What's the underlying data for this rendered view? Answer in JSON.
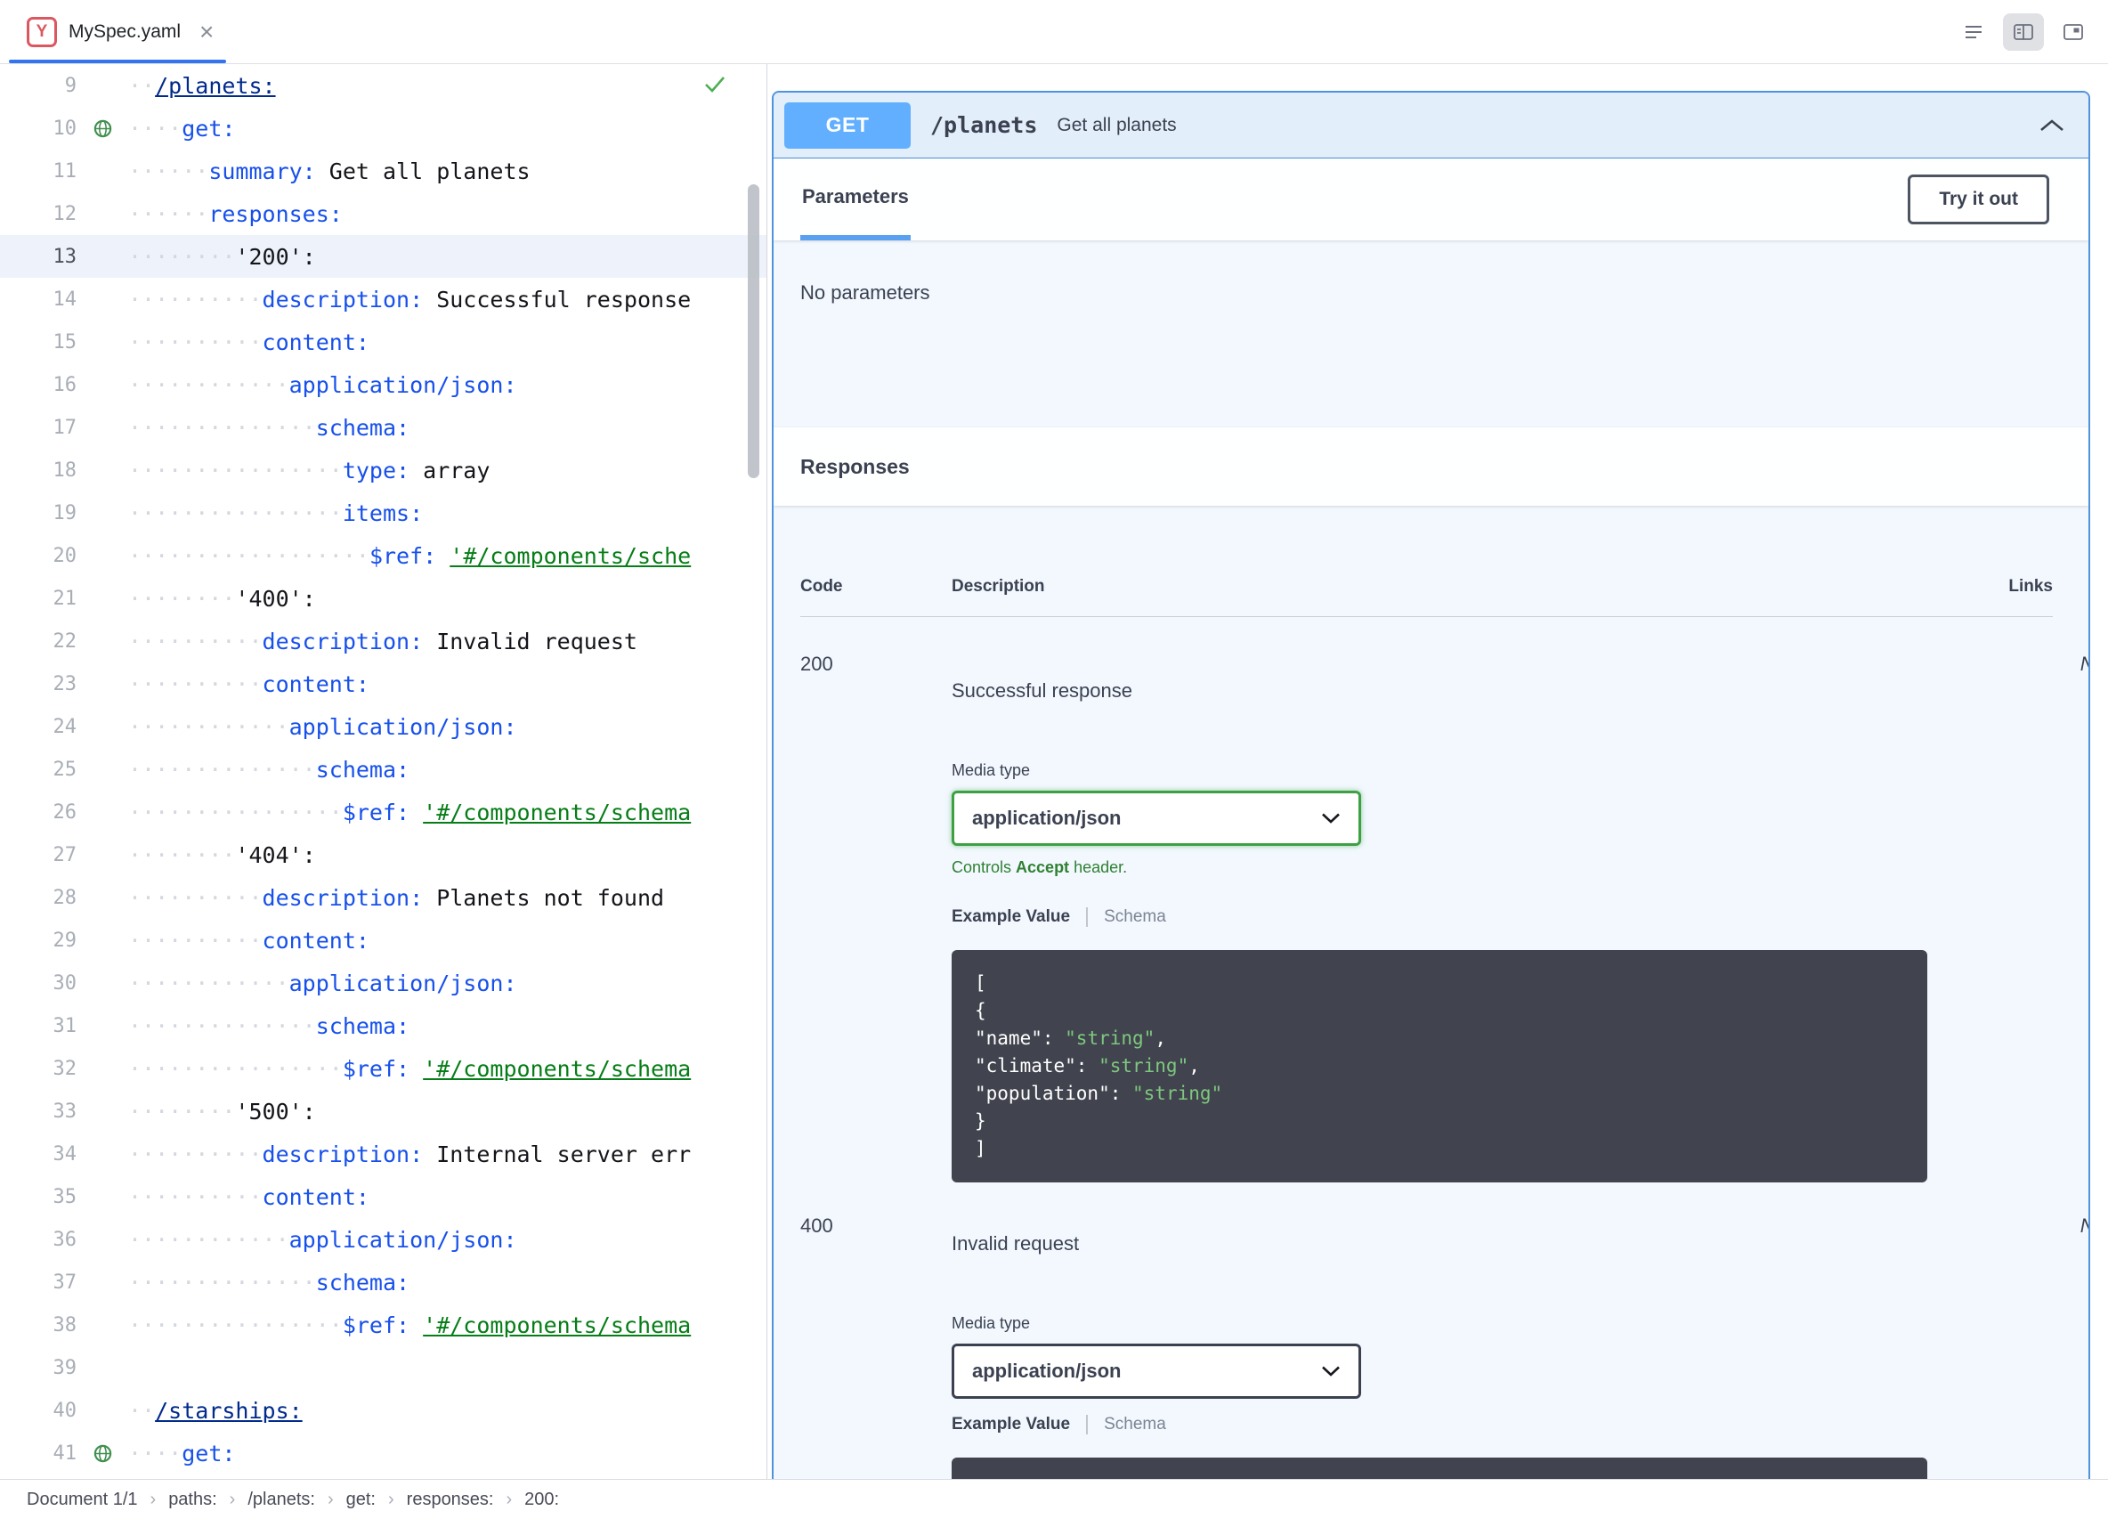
{
  "tab_bar": {
    "tab": {
      "icon_letter": "Y",
      "title": "MySpec.yaml",
      "close_glyph": "×"
    },
    "layout_icons": [
      "editor-only",
      "editor-and-preview",
      "preview-only"
    ]
  },
  "editor": {
    "lines": [
      {
        "n": 9,
        "ind": 2,
        "icon": null,
        "cur": false,
        "tok": [
          [
            "tl",
            "/planets:"
          ]
        ]
      },
      {
        "n": 10,
        "ind": 4,
        "icon": "api",
        "cur": false,
        "tok": [
          [
            "k",
            "get:"
          ]
        ]
      },
      {
        "n": 11,
        "ind": 6,
        "icon": null,
        "cur": false,
        "tok": [
          [
            "k",
            "summary:"
          ],
          [
            "p",
            " Get all planets"
          ]
        ]
      },
      {
        "n": 12,
        "ind": 6,
        "icon": null,
        "cur": false,
        "tok": [
          [
            "k",
            "responses:"
          ]
        ]
      },
      {
        "n": 13,
        "ind": 8,
        "icon": null,
        "cur": true,
        "tok": [
          [
            "p",
            "'200':"
          ]
        ]
      },
      {
        "n": 14,
        "ind": 10,
        "icon": null,
        "cur": false,
        "tok": [
          [
            "k",
            "description:"
          ],
          [
            "p",
            " Successful response"
          ]
        ]
      },
      {
        "n": 15,
        "ind": 10,
        "icon": null,
        "cur": false,
        "tok": [
          [
            "k",
            "content:"
          ]
        ]
      },
      {
        "n": 16,
        "ind": 12,
        "icon": null,
        "cur": false,
        "tok": [
          [
            "k",
            "application/json:"
          ]
        ]
      },
      {
        "n": 17,
        "ind": 14,
        "icon": null,
        "cur": false,
        "tok": [
          [
            "k",
            "schema:"
          ]
        ]
      },
      {
        "n": 18,
        "ind": 16,
        "icon": null,
        "cur": false,
        "tok": [
          [
            "k",
            "type:"
          ],
          [
            "p",
            " array"
          ]
        ]
      },
      {
        "n": 19,
        "ind": 16,
        "icon": null,
        "cur": false,
        "tok": [
          [
            "k",
            "items:"
          ]
        ]
      },
      {
        "n": 20,
        "ind": 18,
        "icon": null,
        "cur": false,
        "tok": [
          [
            "k",
            "$ref:"
          ],
          [
            "p",
            " "
          ],
          [
            "sl",
            "'#/components/sche"
          ]
        ]
      },
      {
        "n": 21,
        "ind": 8,
        "icon": null,
        "cur": false,
        "tok": [
          [
            "p",
            "'400':"
          ]
        ]
      },
      {
        "n": 22,
        "ind": 10,
        "icon": null,
        "cur": false,
        "tok": [
          [
            "k",
            "description:"
          ],
          [
            "p",
            " Invalid request"
          ]
        ]
      },
      {
        "n": 23,
        "ind": 10,
        "icon": null,
        "cur": false,
        "tok": [
          [
            "k",
            "content:"
          ]
        ]
      },
      {
        "n": 24,
        "ind": 12,
        "icon": null,
        "cur": false,
        "tok": [
          [
            "k",
            "application/json:"
          ]
        ]
      },
      {
        "n": 25,
        "ind": 14,
        "icon": null,
        "cur": false,
        "tok": [
          [
            "k",
            "schema:"
          ]
        ]
      },
      {
        "n": 26,
        "ind": 16,
        "icon": null,
        "cur": false,
        "tok": [
          [
            "k",
            "$ref:"
          ],
          [
            "p",
            " "
          ],
          [
            "sl",
            "'#/components/schema"
          ]
        ]
      },
      {
        "n": 27,
        "ind": 8,
        "icon": null,
        "cur": false,
        "tok": [
          [
            "p",
            "'404':"
          ]
        ]
      },
      {
        "n": 28,
        "ind": 10,
        "icon": null,
        "cur": false,
        "tok": [
          [
            "k",
            "description:"
          ],
          [
            "p",
            " Planets not found"
          ]
        ]
      },
      {
        "n": 29,
        "ind": 10,
        "icon": null,
        "cur": false,
        "tok": [
          [
            "k",
            "content:"
          ]
        ]
      },
      {
        "n": 30,
        "ind": 12,
        "icon": null,
        "cur": false,
        "tok": [
          [
            "k",
            "application/json:"
          ]
        ]
      },
      {
        "n": 31,
        "ind": 14,
        "icon": null,
        "cur": false,
        "tok": [
          [
            "k",
            "schema:"
          ]
        ]
      },
      {
        "n": 32,
        "ind": 16,
        "icon": null,
        "cur": false,
        "tok": [
          [
            "k",
            "$ref:"
          ],
          [
            "p",
            " "
          ],
          [
            "sl",
            "'#/components/schema"
          ]
        ]
      },
      {
        "n": 33,
        "ind": 8,
        "icon": null,
        "cur": false,
        "tok": [
          [
            "p",
            "'500':"
          ]
        ]
      },
      {
        "n": 34,
        "ind": 10,
        "icon": null,
        "cur": false,
        "tok": [
          [
            "k",
            "description:"
          ],
          [
            "p",
            " Internal server err"
          ]
        ]
      },
      {
        "n": 35,
        "ind": 10,
        "icon": null,
        "cur": false,
        "tok": [
          [
            "k",
            "content:"
          ]
        ]
      },
      {
        "n": 36,
        "ind": 12,
        "icon": null,
        "cur": false,
        "tok": [
          [
            "k",
            "application/json:"
          ]
        ]
      },
      {
        "n": 37,
        "ind": 14,
        "icon": null,
        "cur": false,
        "tok": [
          [
            "k",
            "schema:"
          ]
        ]
      },
      {
        "n": 38,
        "ind": 16,
        "icon": null,
        "cur": false,
        "tok": [
          [
            "k",
            "$ref:"
          ],
          [
            "p",
            " "
          ],
          [
            "sl",
            "'#/components/schema"
          ]
        ]
      },
      {
        "n": 39,
        "ind": 0,
        "icon": null,
        "cur": false,
        "tok": []
      },
      {
        "n": 40,
        "ind": 2,
        "icon": null,
        "cur": false,
        "tok": [
          [
            "tl",
            "/starships:"
          ]
        ]
      },
      {
        "n": 41,
        "ind": 4,
        "icon": "api",
        "cur": false,
        "tok": [
          [
            "k",
            "get:"
          ]
        ]
      }
    ]
  },
  "preview": {
    "operation": {
      "method": "GET",
      "path": "/planets",
      "summary": "Get all planets"
    },
    "parameters": {
      "tab_label": "Parameters",
      "try_it_out": "Try it out",
      "empty": "No parameters"
    },
    "responses_section": {
      "title": "Responses",
      "headers": {
        "code": "Code",
        "description": "Description",
        "links": "Links"
      }
    },
    "responses": [
      {
        "code": "200",
        "description": "Successful response",
        "links": "No links",
        "media_type_label": "Media type",
        "media_type": "application/json",
        "controls_prefix": "Controls ",
        "controls_bold": "Accept",
        "controls_suffix": " header.",
        "example_tab": "Example Value",
        "schema_tab": "Schema",
        "example_lines": [
          [
            [
              "w",
              "["
            ]
          ],
          [
            [
              "w",
              "  {"
            ]
          ],
          [
            [
              "w",
              "    \"name\": "
            ],
            [
              "g",
              "\"string\""
            ],
            [
              "w",
              ","
            ]
          ],
          [
            [
              "w",
              "    \"climate\": "
            ],
            [
              "g",
              "\"string\""
            ],
            [
              "w",
              ","
            ]
          ],
          [
            [
              "w",
              "    \"population\": "
            ],
            [
              "g",
              "\"string\""
            ]
          ],
          [
            [
              "w",
              "  }"
            ]
          ],
          [
            [
              "w",
              "]"
            ]
          ]
        ]
      },
      {
        "code": "400",
        "description": "Invalid request",
        "links": "No links",
        "media_type_label": "Media type",
        "media_type": "application/json",
        "example_tab": "Example Value",
        "schema_tab": "Schema",
        "example_lines": [
          [
            [
              "w",
              "{"
            ]
          ]
        ]
      }
    ]
  },
  "status_bar": {
    "document": "Document 1/1",
    "separator": "›",
    "crumbs": [
      "paths:",
      "/planets:",
      "get:",
      "responses:",
      "200:"
    ]
  },
  "colors": {
    "method_get": "#61affe",
    "opblock_border": "#4f93dd",
    "tab_accent": "#3574f0",
    "yaml_key": "#1750eb",
    "yaml_string": "#067d17",
    "select_focus_green": "#3da144",
    "example_bg": "#41444e",
    "example_string": "#7ec77e"
  }
}
